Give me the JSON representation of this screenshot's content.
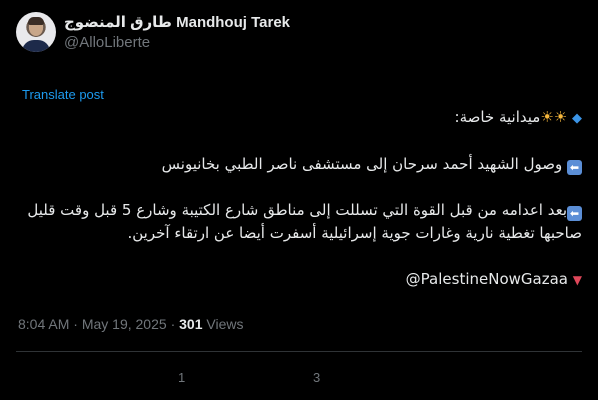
{
  "author": {
    "display_name": "طارق المنضوج Mandhouj Tarek",
    "handle": "@AlloLiberte"
  },
  "translate_label": "Translate post",
  "tweet": {
    "line1_text": "ميدانية خاصة:",
    "line2_text": "وصول الشهيد أحمد سرحان إلى مستشفى ناصر الطبي بخانيونس",
    "line3_text": "بعد اعدامه  من قبل القوة التي تسللت إلى مناطق شارع الكتيبة وشارع 5 قبل وقت قليل صاحبها تغطية نارية وغارات جوية إسرائيلية أسفرت أيضا عن ارتقاء آخرين.",
    "hashtag_text": "@PalestineNowGazaa",
    "icons": [
      "diamond-icon",
      "sun-icon",
      "sun-icon",
      "left-arrow-icon",
      "left-arrow-icon",
      "down-triangle-icon"
    ]
  },
  "meta": {
    "time": "8:04 AM",
    "sep1": "·",
    "date": "May 19, 2025",
    "sep2": "·",
    "views_count": "301",
    "views_label": "Views"
  },
  "stats": {
    "replies": "1",
    "reposts": "3"
  },
  "colors": {
    "background": "#000000",
    "text": "#e7e9ea",
    "muted": "#71767b",
    "link": "#1d9bf0",
    "divider": "#2f3336"
  }
}
